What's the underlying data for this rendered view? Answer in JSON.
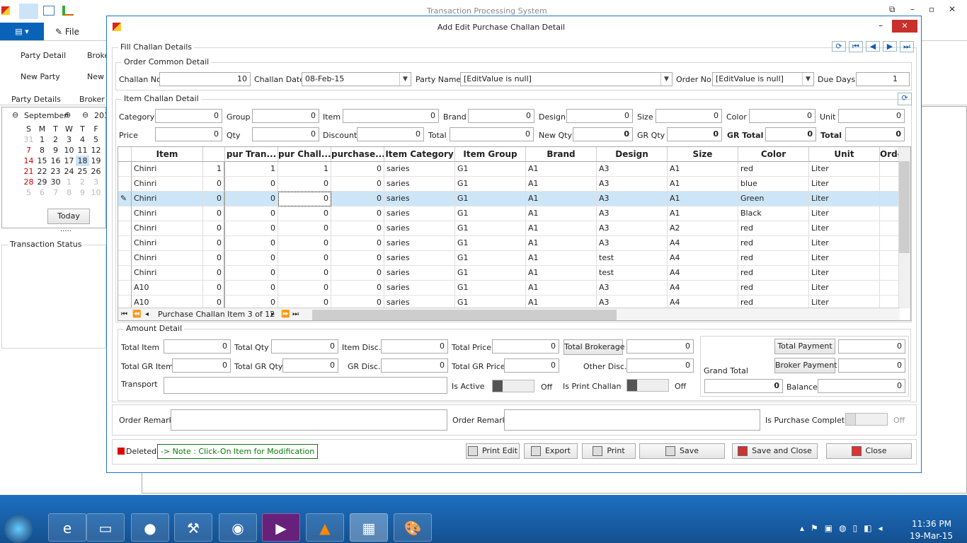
{
  "app": {
    "title": "Transaction Processing System",
    "file_tab": "File",
    "ribbon": {
      "party_detail": "Party Detail",
      "new_party": "New Party",
      "broker_detail": "Broke",
      "new_broker": "New B",
      "group_party": "Party Details",
      "group_broker": "Broker D"
    },
    "calendar": {
      "month": "September",
      "year": "201",
      "days": [
        "S",
        "M",
        "T",
        "W",
        "T",
        "F"
      ],
      "weeks": [
        [
          "31",
          "1",
          "2",
          "3",
          "4",
          "5"
        ],
        [
          "7",
          "8",
          "9",
          "10",
          "11",
          "12"
        ],
        [
          "14",
          "15",
          "16",
          "17",
          "18",
          "19"
        ],
        [
          "21",
          "22",
          "23",
          "24",
          "25",
          "26"
        ],
        [
          "28",
          "29",
          "30",
          "1",
          "2",
          "3"
        ],
        [
          "5",
          "6",
          "7",
          "8",
          "9",
          "10"
        ]
      ],
      "selected": "18",
      "today_label": "Today"
    },
    "transaction_status": "Transaction Status"
  },
  "dialog": {
    "title": "Add Edit Purchase Challan Detail",
    "fill_group": "Fill Challan Details",
    "order_group": "Order Common Detail",
    "order": {
      "challan_no_label": "Challan No",
      "challan_no": "10",
      "challan_date_label": "Challan Date",
      "challan_date": "08-Feb-15",
      "party_name_label": "Party Name",
      "party_name": "[EditValue is null]",
      "order_no_label": "Order No",
      "order_no": "[EditValue is null]",
      "due_days_label": "Due Days",
      "due_days": "1"
    },
    "item_group": "Item Challan Detail",
    "item": {
      "category_label": "Category",
      "category": "0",
      "group_label": "Group",
      "group": "0",
      "item_label": "Item",
      "item": "0",
      "brand_label": "Brand",
      "brand": "0",
      "design_label": "Design",
      "design": "0",
      "size_label": "Size",
      "size": "0",
      "color_label": "Color",
      "color": "0",
      "unit_label": "Unit",
      "unit": "0",
      "price_label": "Price",
      "price": "0",
      "qty_label": "Qty",
      "qty": "0",
      "discount_label": "Discount",
      "discount": "0",
      "total_label": "Total",
      "total": "0",
      "new_qty_label": "New Qty",
      "new_qty": "0",
      "gr_qty_label": "GR Qty",
      "gr_qty": "0",
      "gr_total_label": "GR Total",
      "gr_total": "0",
      "total2_label": "Total",
      "total2": "0"
    },
    "grid": {
      "columns": [
        "Item",
        "",
        "pur Tran...",
        "pur Chall...",
        "purchase...",
        "Item Category",
        "Item Group",
        "Brand",
        "Design",
        "Size",
        "Color",
        "Unit",
        "Orde"
      ],
      "rows": [
        [
          "Chinri",
          "1",
          "1",
          "1",
          "0",
          "saries",
          "G1",
          "A1",
          "A3",
          "A1",
          "red",
          "Liter",
          ""
        ],
        [
          "Chinri",
          "0",
          "0",
          "0",
          "0",
          "saries",
          "G1",
          "A1",
          "A3",
          "A1",
          "blue",
          "Liter",
          ""
        ],
        [
          "Chinri",
          "0",
          "0",
          "0",
          "0",
          "saries",
          "G1",
          "A1",
          "A3",
          "A1",
          "Green",
          "Liter",
          ""
        ],
        [
          "Chinri",
          "0",
          "0",
          "0",
          "0",
          "saries",
          "G1",
          "A1",
          "A3",
          "A1",
          "Black",
          "Liter",
          ""
        ],
        [
          "Chinri",
          "0",
          "0",
          "0",
          "0",
          "saries",
          "G1",
          "A1",
          "A3",
          "A2",
          "red",
          "Liter",
          ""
        ],
        [
          "Chinri",
          "0",
          "0",
          "0",
          "0",
          "saries",
          "G1",
          "A1",
          "A3",
          "A4",
          "red",
          "Liter",
          ""
        ],
        [
          "Chinri",
          "0",
          "0",
          "0",
          "0",
          "saries",
          "G1",
          "A1",
          "test",
          "A4",
          "red",
          "Liter",
          ""
        ],
        [
          "Chinri",
          "0",
          "0",
          "0",
          "0",
          "saries",
          "G1",
          "A1",
          "test",
          "A4",
          "red",
          "Liter",
          ""
        ],
        [
          "A10",
          "0",
          "0",
          "0",
          "0",
          "saries",
          "G1",
          "A1",
          "A3",
          "A4",
          "red",
          "Liter",
          ""
        ],
        [
          "A10",
          "0",
          "0",
          "0",
          "0",
          "saries",
          "G1",
          "A1",
          "A3",
          "A4",
          "red",
          "Liter",
          ""
        ]
      ],
      "selected_row": 3,
      "navigator": "Purchase Challan Item 3 of 12"
    },
    "amount_group": "Amount Detail",
    "amount": {
      "total_item_label": "Total Item",
      "total_item": "0",
      "total_qty_label": "Total Qty",
      "total_qty": "0",
      "item_disc_label": "Item Disc.",
      "item_disc": "0",
      "total_price_label": "Total Price",
      "total_price": "0",
      "total_brokerage_label": "Total Brokerage",
      "total_brokerage": "0",
      "total_gr_item_label": "Total GR Item",
      "total_gr_item": "0",
      "total_gr_qty_label": "Total GR Qty.",
      "total_gr_qty": "0",
      "gr_disc_label": "GR Disc.",
      "gr_disc": "0",
      "total_gr_price_label": "Total GR Price",
      "total_gr_price": "0",
      "other_disc_label": "Other Disc.",
      "other_disc": "0",
      "transport_label": "Transport",
      "is_active_label": "Is Active",
      "is_active": "Off",
      "is_print_label": "Is Print Challan",
      "is_print": "Off",
      "total_payment_label": "Total Payment",
      "total_payment": "0",
      "broker_payment_label": "Broker Payment",
      "broker_payment": "0",
      "grand_total_label": "Grand Total",
      "grand_total": "0",
      "balance_label": "Balance",
      "balance": "0"
    },
    "remark": {
      "order_remark_label": "Order Remark",
      "order_remark2_label": "Order Remark",
      "purchase_complete_label": "Is Purchase Complete",
      "purchase_complete": "Off"
    },
    "footer": {
      "deleted": "Deleted",
      "note": "-> Note : Click-On Item for Modification",
      "print_edit": "Print Edit",
      "export": "Export",
      "print": "Print",
      "save": "Save",
      "save_close": "Save and Close",
      "close": "Close"
    }
  },
  "taskbar": {
    "time": "11:36 PM",
    "date": "19-Mar-15"
  },
  "colors": {
    "accent": "#0a63b8",
    "selected_row": "#cde6f7",
    "deleted": "#e00000",
    "note": "#0a7a0a",
    "taskbar": "#1a5ea8"
  }
}
